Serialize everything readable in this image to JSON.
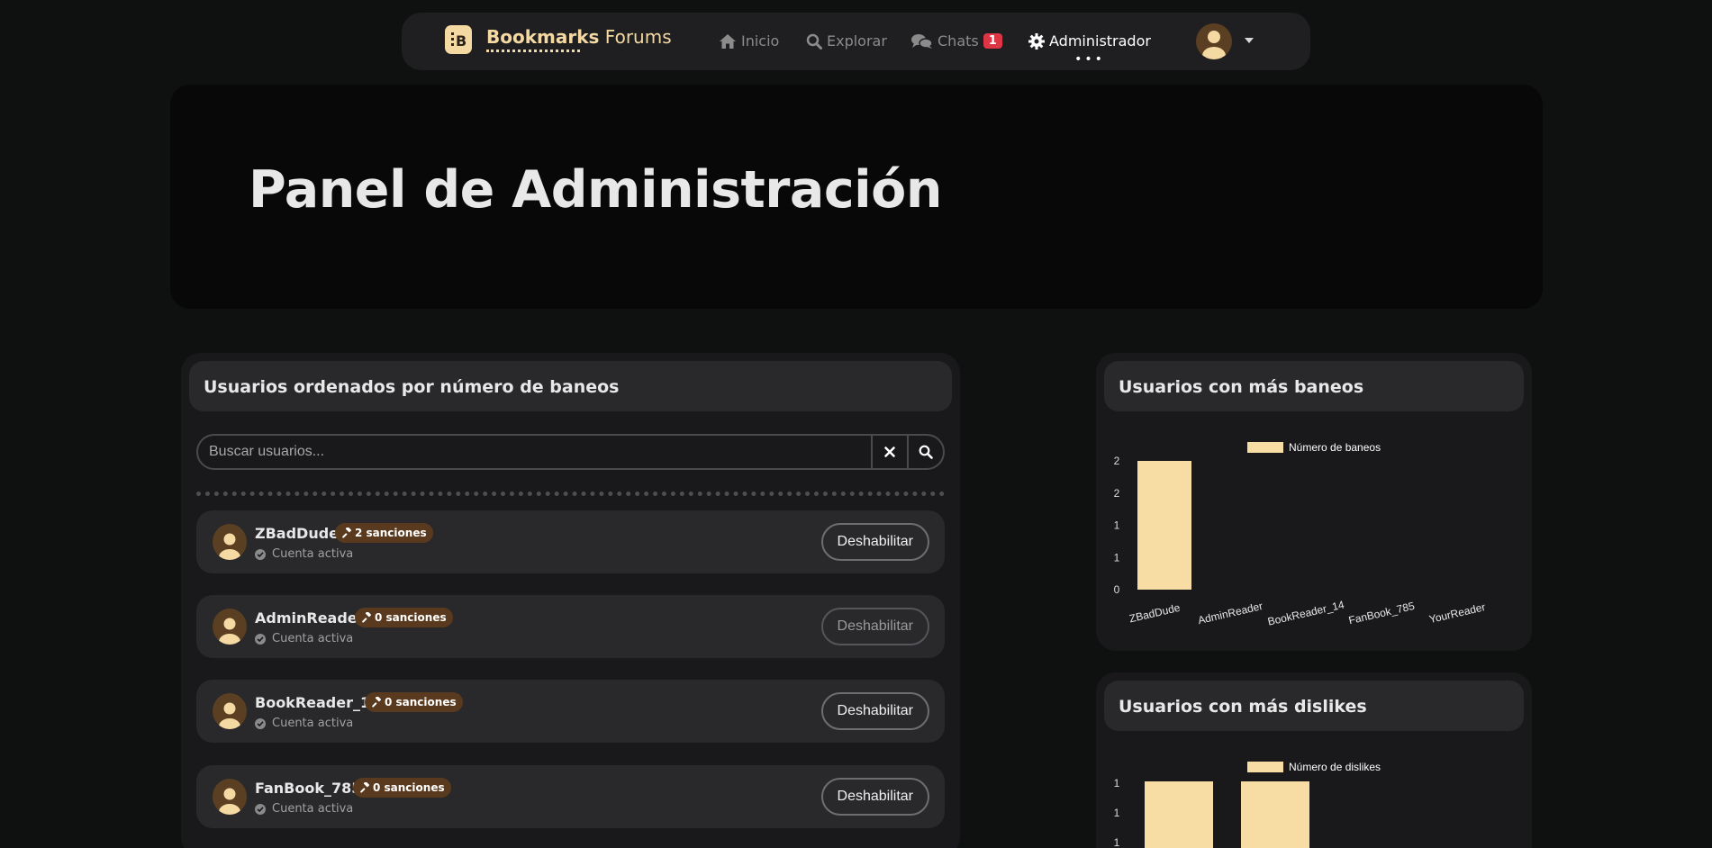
{
  "nav": {
    "brand_bold": "Bookmarks",
    "brand_light": "Forums",
    "brand_icon": "book-logo-icon",
    "items": [
      {
        "label": "Inicio",
        "icon": "home-icon"
      },
      {
        "label": "Explorar",
        "icon": "search-icon"
      },
      {
        "label": "Chats",
        "icon": "chat-bubbles-icon",
        "badge": "1"
      },
      {
        "label": "Administrador",
        "icon": "gear-icon",
        "active": true
      }
    ]
  },
  "hero": {
    "title": "Panel de Administración"
  },
  "users_panel": {
    "title": "Usuarios ordenados por número de baneos",
    "search_placeholder": "Buscar usuarios...",
    "users": [
      {
        "name": "ZBadDude",
        "sanctions": "2 sanciones",
        "status": "Cuenta activa",
        "action": "Deshabilitar"
      },
      {
        "name": "AdminReader",
        "sanctions": "0 sanciones",
        "status": "Cuenta activa",
        "action": "Deshabilitar"
      },
      {
        "name": "BookReader_14",
        "sanctions": "0 sanciones",
        "status": "Cuenta activa",
        "action": "Deshabilitar"
      },
      {
        "name": "FanBook_785",
        "sanctions": "0 sanciones",
        "status": "Cuenta activa",
        "action": "Deshabilitar"
      }
    ]
  },
  "colors": {
    "accent": "#f5d9a3",
    "badge": "#dc3545",
    "sanction_bg": "#5a3a1e"
  },
  "chart_data": [
    {
      "type": "bar",
      "title": "Usuarios con más baneos",
      "categories": [
        "ZBadDude",
        "AdminReader",
        "BookReader_14",
        "FanBook_785",
        "YourReader"
      ],
      "series": [
        {
          "name": "Número de baneos",
          "values": [
            2,
            0,
            0,
            0,
            0
          ]
        }
      ],
      "ytick_labels": [
        "0",
        "1",
        "1",
        "2",
        "2"
      ],
      "ylim": [
        0,
        2
      ],
      "legend": "top",
      "color": "#f7dca3"
    },
    {
      "type": "bar",
      "title": "Usuarios con más dislikes",
      "series": [
        {
          "name": "Número de dislikes",
          "values": [
            1,
            1
          ]
        }
      ],
      "ytick_labels": [
        "1",
        "1",
        "1"
      ],
      "legend": "top",
      "color": "#f7dca3"
    }
  ]
}
